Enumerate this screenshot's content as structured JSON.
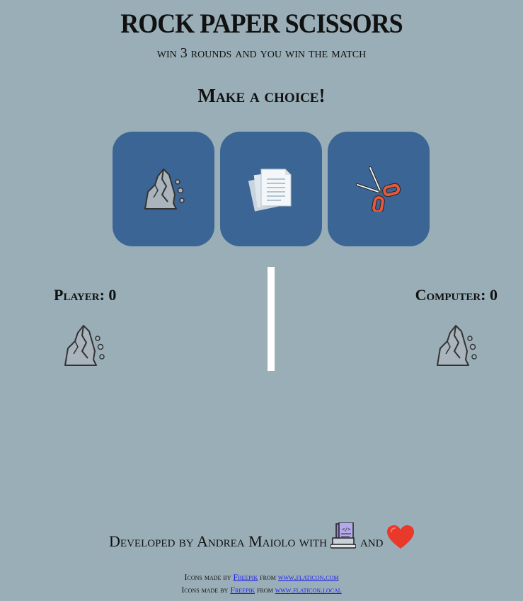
{
  "header": {
    "title": "ROCK PAPER SCISSORS",
    "subtitle": "win 3 rounds and you win the match",
    "prompt": "Make a choice!"
  },
  "choices": [
    {
      "name": "rock",
      "icon": "rock-icon"
    },
    {
      "name": "paper",
      "icon": "paper-icon"
    },
    {
      "name": "scissors",
      "icon": "scissors-icon"
    }
  ],
  "scoreboard": {
    "player_label": "Player:",
    "player_score": "0",
    "computer_label": "Computer:",
    "computer_score": "0",
    "player_pick_icon": "rock-icon",
    "computer_pick_icon": "rock-icon"
  },
  "footer": {
    "developed_text": "Developed by Andrea Maiolo with",
    "and_text": "and",
    "icon_1": "laptop-code-icon",
    "icon_2": "heart-icon"
  },
  "credits": [
    {
      "prefix": "Icons made by",
      "author": "Freepik",
      "middle": "from",
      "site": "www.flaticon.com"
    },
    {
      "prefix": "Icons made by",
      "author": "Freepik",
      "middle": "from",
      "site": "www.flaticon.local"
    }
  ],
  "colors": {
    "background": "#9aaeb7",
    "card": "#3b6594",
    "divider": "#ffffff",
    "link": "#1a1aee",
    "heart": "#e8392a"
  }
}
